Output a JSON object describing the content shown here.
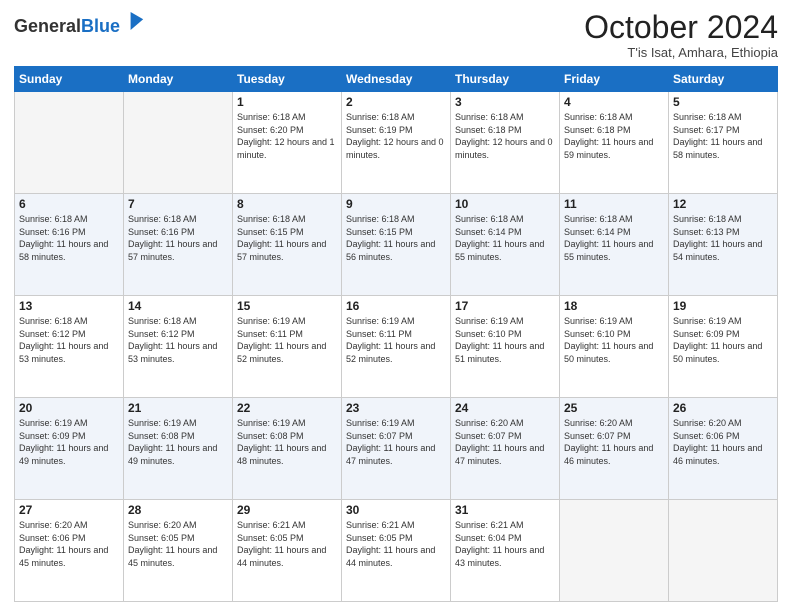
{
  "header": {
    "logo_general": "General",
    "logo_blue": "Blue",
    "month_title": "October 2024",
    "subtitle": "T'is Isat, Amhara, Ethiopia"
  },
  "days_of_week": [
    "Sunday",
    "Monday",
    "Tuesday",
    "Wednesday",
    "Thursday",
    "Friday",
    "Saturday"
  ],
  "weeks": [
    [
      {
        "day": "",
        "sunrise": "",
        "sunset": "",
        "daylight": ""
      },
      {
        "day": "",
        "sunrise": "",
        "sunset": "",
        "daylight": ""
      },
      {
        "day": "1",
        "sunrise": "Sunrise: 6:18 AM",
        "sunset": "Sunset: 6:20 PM",
        "daylight": "Daylight: 12 hours and 1 minute."
      },
      {
        "day": "2",
        "sunrise": "Sunrise: 6:18 AM",
        "sunset": "Sunset: 6:19 PM",
        "daylight": "Daylight: 12 hours and 0 minutes."
      },
      {
        "day": "3",
        "sunrise": "Sunrise: 6:18 AM",
        "sunset": "Sunset: 6:18 PM",
        "daylight": "Daylight: 12 hours and 0 minutes."
      },
      {
        "day": "4",
        "sunrise": "Sunrise: 6:18 AM",
        "sunset": "Sunset: 6:18 PM",
        "daylight": "Daylight: 11 hours and 59 minutes."
      },
      {
        "day": "5",
        "sunrise": "Sunrise: 6:18 AM",
        "sunset": "Sunset: 6:17 PM",
        "daylight": "Daylight: 11 hours and 58 minutes."
      }
    ],
    [
      {
        "day": "6",
        "sunrise": "Sunrise: 6:18 AM",
        "sunset": "Sunset: 6:16 PM",
        "daylight": "Daylight: 11 hours and 58 minutes."
      },
      {
        "day": "7",
        "sunrise": "Sunrise: 6:18 AM",
        "sunset": "Sunset: 6:16 PM",
        "daylight": "Daylight: 11 hours and 57 minutes."
      },
      {
        "day": "8",
        "sunrise": "Sunrise: 6:18 AM",
        "sunset": "Sunset: 6:15 PM",
        "daylight": "Daylight: 11 hours and 57 minutes."
      },
      {
        "day": "9",
        "sunrise": "Sunrise: 6:18 AM",
        "sunset": "Sunset: 6:15 PM",
        "daylight": "Daylight: 11 hours and 56 minutes."
      },
      {
        "day": "10",
        "sunrise": "Sunrise: 6:18 AM",
        "sunset": "Sunset: 6:14 PM",
        "daylight": "Daylight: 11 hours and 55 minutes."
      },
      {
        "day": "11",
        "sunrise": "Sunrise: 6:18 AM",
        "sunset": "Sunset: 6:14 PM",
        "daylight": "Daylight: 11 hours and 55 minutes."
      },
      {
        "day": "12",
        "sunrise": "Sunrise: 6:18 AM",
        "sunset": "Sunset: 6:13 PM",
        "daylight": "Daylight: 11 hours and 54 minutes."
      }
    ],
    [
      {
        "day": "13",
        "sunrise": "Sunrise: 6:18 AM",
        "sunset": "Sunset: 6:12 PM",
        "daylight": "Daylight: 11 hours and 53 minutes."
      },
      {
        "day": "14",
        "sunrise": "Sunrise: 6:18 AM",
        "sunset": "Sunset: 6:12 PM",
        "daylight": "Daylight: 11 hours and 53 minutes."
      },
      {
        "day": "15",
        "sunrise": "Sunrise: 6:19 AM",
        "sunset": "Sunset: 6:11 PM",
        "daylight": "Daylight: 11 hours and 52 minutes."
      },
      {
        "day": "16",
        "sunrise": "Sunrise: 6:19 AM",
        "sunset": "Sunset: 6:11 PM",
        "daylight": "Daylight: 11 hours and 52 minutes."
      },
      {
        "day": "17",
        "sunrise": "Sunrise: 6:19 AM",
        "sunset": "Sunset: 6:10 PM",
        "daylight": "Daylight: 11 hours and 51 minutes."
      },
      {
        "day": "18",
        "sunrise": "Sunrise: 6:19 AM",
        "sunset": "Sunset: 6:10 PM",
        "daylight": "Daylight: 11 hours and 50 minutes."
      },
      {
        "day": "19",
        "sunrise": "Sunrise: 6:19 AM",
        "sunset": "Sunset: 6:09 PM",
        "daylight": "Daylight: 11 hours and 50 minutes."
      }
    ],
    [
      {
        "day": "20",
        "sunrise": "Sunrise: 6:19 AM",
        "sunset": "Sunset: 6:09 PM",
        "daylight": "Daylight: 11 hours and 49 minutes."
      },
      {
        "day": "21",
        "sunrise": "Sunrise: 6:19 AM",
        "sunset": "Sunset: 6:08 PM",
        "daylight": "Daylight: 11 hours and 49 minutes."
      },
      {
        "day": "22",
        "sunrise": "Sunrise: 6:19 AM",
        "sunset": "Sunset: 6:08 PM",
        "daylight": "Daylight: 11 hours and 48 minutes."
      },
      {
        "day": "23",
        "sunrise": "Sunrise: 6:19 AM",
        "sunset": "Sunset: 6:07 PM",
        "daylight": "Daylight: 11 hours and 47 minutes."
      },
      {
        "day": "24",
        "sunrise": "Sunrise: 6:20 AM",
        "sunset": "Sunset: 6:07 PM",
        "daylight": "Daylight: 11 hours and 47 minutes."
      },
      {
        "day": "25",
        "sunrise": "Sunrise: 6:20 AM",
        "sunset": "Sunset: 6:07 PM",
        "daylight": "Daylight: 11 hours and 46 minutes."
      },
      {
        "day": "26",
        "sunrise": "Sunrise: 6:20 AM",
        "sunset": "Sunset: 6:06 PM",
        "daylight": "Daylight: 11 hours and 46 minutes."
      }
    ],
    [
      {
        "day": "27",
        "sunrise": "Sunrise: 6:20 AM",
        "sunset": "Sunset: 6:06 PM",
        "daylight": "Daylight: 11 hours and 45 minutes."
      },
      {
        "day": "28",
        "sunrise": "Sunrise: 6:20 AM",
        "sunset": "Sunset: 6:05 PM",
        "daylight": "Daylight: 11 hours and 45 minutes."
      },
      {
        "day": "29",
        "sunrise": "Sunrise: 6:21 AM",
        "sunset": "Sunset: 6:05 PM",
        "daylight": "Daylight: 11 hours and 44 minutes."
      },
      {
        "day": "30",
        "sunrise": "Sunrise: 6:21 AM",
        "sunset": "Sunset: 6:05 PM",
        "daylight": "Daylight: 11 hours and 44 minutes."
      },
      {
        "day": "31",
        "sunrise": "Sunrise: 6:21 AM",
        "sunset": "Sunset: 6:04 PM",
        "daylight": "Daylight: 11 hours and 43 minutes."
      },
      {
        "day": "",
        "sunrise": "",
        "sunset": "",
        "daylight": ""
      },
      {
        "day": "",
        "sunrise": "",
        "sunset": "",
        "daylight": ""
      }
    ]
  ]
}
